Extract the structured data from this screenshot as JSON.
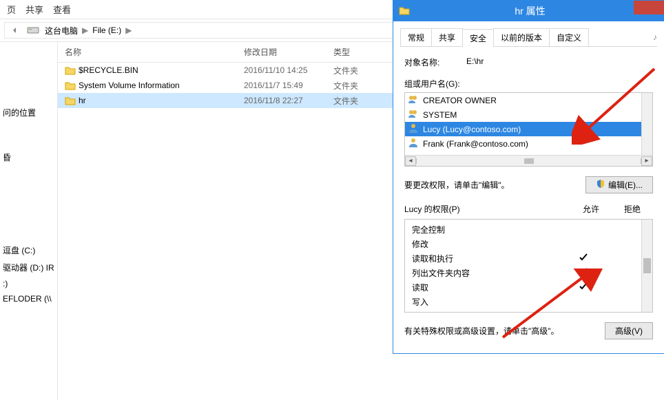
{
  "explorer": {
    "ribbon": {
      "tab1": "页",
      "tab2": "共享",
      "tab3": "查看"
    },
    "breadcrumb": {
      "pc": "这台电脑",
      "drive": "File (E:)"
    },
    "columns": {
      "name": "名称",
      "date": "修改日期",
      "type": "类型"
    },
    "rows": [
      {
        "name": "$RECYCLE.BIN",
        "date": "2016/11/10 14:25",
        "type": "文件夹",
        "selected": false
      },
      {
        "name": "System Volume Information",
        "date": "2016/11/7 15:49",
        "type": "文件夹",
        "selected": false
      },
      {
        "name": "hr",
        "date": "2016/11/8 22:27",
        "type": "文件夹",
        "selected": true
      }
    ],
    "nav": {
      "i0": "问的位置",
      "i1": "昏",
      "i2": "逗盘 (C:)",
      "i3": "驱动器 (D:) IR",
      "i4": ":)",
      "i5": "EFLODER (\\\\"
    }
  },
  "dialog": {
    "title": "hr 属性",
    "tabs": {
      "t1": "常规",
      "t2": "共享",
      "t3": "安全",
      "t4": "以前的版本",
      "t5": "自定义"
    },
    "object_label": "对象名称:",
    "object_value": "E:\\hr",
    "users_label": "组或用户名(G):",
    "users": [
      {
        "name": "CREATOR OWNER",
        "kind": "group"
      },
      {
        "name": "SYSTEM",
        "kind": "group"
      },
      {
        "name": "Lucy (Lucy@contoso.com)",
        "kind": "user",
        "selected": true
      },
      {
        "name": "Frank (Frank@contoso.com)",
        "kind": "user"
      }
    ],
    "edit_hint": "要更改权限，请单击\"编辑\"。",
    "edit_button": "编辑(E)...",
    "perm_label": "Lucy 的权限(P)",
    "allow": "允许",
    "deny": "拒绝",
    "perms": [
      {
        "name": "完全控制",
        "allow": false
      },
      {
        "name": "修改",
        "allow": false
      },
      {
        "name": "读取和执行",
        "allow": true
      },
      {
        "name": "列出文件夹内容",
        "allow": true
      },
      {
        "name": "读取",
        "allow": true
      },
      {
        "name": "写入",
        "allow": false
      }
    ],
    "adv_hint": "有关特殊权限或高级设置，请单击\"高级\"。",
    "adv_button": "高级(V)"
  }
}
